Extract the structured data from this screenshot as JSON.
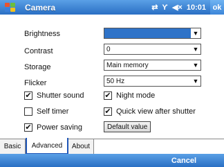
{
  "titlebar": {
    "title": "Camera",
    "time": "10:01",
    "ok_label": "ok",
    "tray_icons": [
      "connectivity-icon",
      "phone-signal-icon",
      "speaker-icon"
    ]
  },
  "settings": {
    "brightness": {
      "label": "Brightness",
      "value": ""
    },
    "contrast": {
      "label": "Contrast",
      "value": "0"
    },
    "storage": {
      "label": "Storage",
      "value": "Main memory"
    },
    "flicker": {
      "label": "Flicker",
      "value": "50 Hz"
    }
  },
  "checkboxes": {
    "shutter_sound": {
      "label": "Shutter sound",
      "checked": true
    },
    "self_timer": {
      "label": "Self timer",
      "checked": false
    },
    "power_saving": {
      "label": "Power saving",
      "checked": true
    },
    "night_mode": {
      "label": "Night mode",
      "checked": true
    },
    "quick_view": {
      "label": "Quick view after shutter",
      "checked": true
    }
  },
  "default_button": "Default value",
  "tabs": [
    {
      "label": "Basic",
      "active": false
    },
    {
      "label": "Advanced",
      "active": true
    },
    {
      "label": "About",
      "active": false
    }
  ],
  "bottom": {
    "cancel_label": "Cancel"
  },
  "colors": {
    "titlebar": "#2a6fc4",
    "selection": "#2f73c8",
    "active_tab_border": "#1f56b8"
  }
}
